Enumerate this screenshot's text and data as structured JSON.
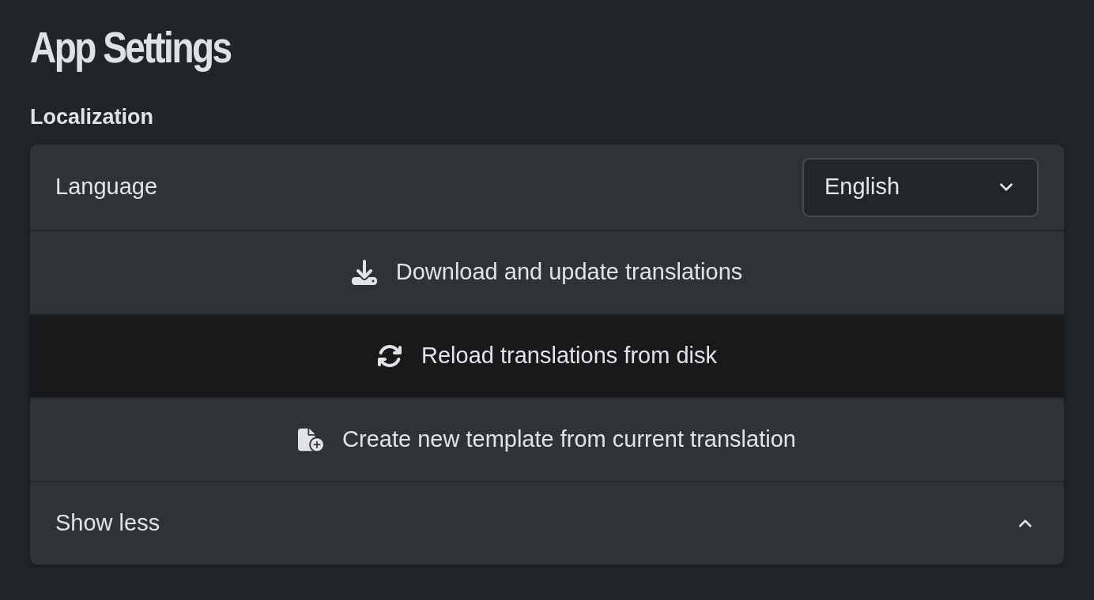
{
  "page": {
    "title": "App Settings"
  },
  "section": {
    "heading": "Localization",
    "language": {
      "label": "Language",
      "value": "English",
      "expanded": false
    },
    "actions": [
      {
        "kind": "download",
        "label": "Download and update translations",
        "hovered": false
      },
      {
        "kind": "reload",
        "label": "Reload translations from disk",
        "hovered": true
      },
      {
        "kind": "new-template",
        "label": "Create new template from current translation",
        "hovered": false
      }
    ],
    "toggle": {
      "label": "Show less",
      "expanded": true
    }
  }
}
